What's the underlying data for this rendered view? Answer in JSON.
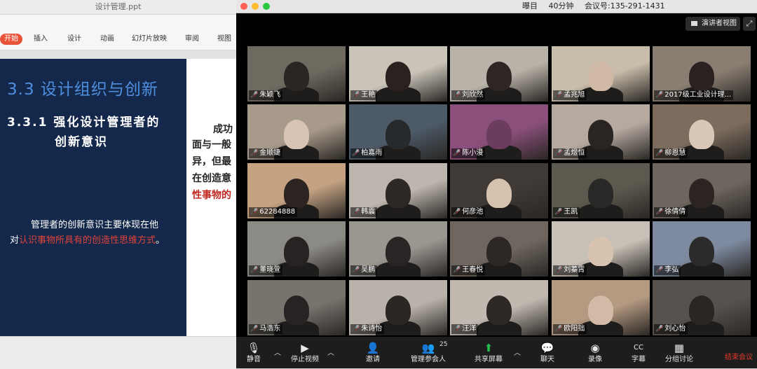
{
  "ppt": {
    "title": "设计管理.ppt",
    "tabs": [
      "开始",
      "插入",
      "设计",
      "动画",
      "幻灯片放映",
      "审阅",
      "视图"
    ],
    "slide": {
      "heading": "3.3 设计组织与创新",
      "subheading_line1": "3.3.1 强化设计管理者的",
      "subheading_line2": "创新意识",
      "para_line1": "管理者的创新意识主要体现在他",
      "para_line2_prefix": "对",
      "para_line2_red": "认识事物所具有的创造性思维方式",
      "para_line2_suffix": "。",
      "right_lines": [
        "成功",
        "面与一般",
        "异，但最",
        "在创造意",
        "性事物的"
      ]
    }
  },
  "zoom": {
    "title_parts": [
      "曝目",
      "40分钟",
      "会议号:135-291-1431"
    ],
    "speaker_view": "演讲者视图",
    "participants": [
      {
        "name": "朱颖飞",
        "wall": "#6f6a60",
        "skin": "#2a2624"
      },
      {
        "name": "王艳",
        "wall": "#c9c3b8",
        "skin": "#2b2220"
      },
      {
        "name": "刘欣然",
        "wall": "#b9b2a8",
        "skin": "#2e2623"
      },
      {
        "name": "孟兆旭",
        "wall": "#c8bcaa",
        "skin": "#cfb9a5"
      },
      {
        "name": "2017级工业设计理...",
        "wall": "#8a7e72",
        "skin": "#2a2220"
      },
      {
        "name": "金顺婕",
        "wall": "#a89a8a",
        "skin": "#d8c4b4"
      },
      {
        "name": "柏嘉雨",
        "wall": "#4d5a68",
        "skin": "#272a2c"
      },
      {
        "name": "陈小漫",
        "wall": "#8b4f7c",
        "skin": "#6b3c5e"
      },
      {
        "name": "孟煜恒",
        "wall": "#b5a9a0",
        "skin": "#2a2522"
      },
      {
        "name": "柳恩慧",
        "wall": "#7c6c5e",
        "skin": "#d9c7b8"
      },
      {
        "name": "62284888",
        "wall": "#c4a282",
        "skin": "#2b2420"
      },
      {
        "name": "韩震",
        "wall": "#bdb6ae",
        "skin": "#2d2826"
      },
      {
        "name": "何彦池",
        "wall": "#3f3a35",
        "skin": "#d6c2af"
      },
      {
        "name": "王凯",
        "wall": "#5c5a4f",
        "skin": "#2a2826"
      },
      {
        "name": "徐倩倩",
        "wall": "#6d655e",
        "skin": "#2c2422"
      },
      {
        "name": "董晓萱",
        "wall": "#8c8a84",
        "skin": "#272322"
      },
      {
        "name": "吴鹏",
        "wall": "#9a9690",
        "skin": "#292524"
      },
      {
        "name": "王春悦",
        "wall": "#6e665f",
        "skin": "#2d2725"
      },
      {
        "name": "刘蓁霄",
        "wall": "#c7c0b6",
        "skin": "#d8c3b0"
      },
      {
        "name": "李弘",
        "wall": "#7d8aa0",
        "skin": "#2c2a2a"
      },
      {
        "name": "马浩东",
        "wall": "#77736d",
        "skin": "#262322"
      },
      {
        "name": "朱诗怡",
        "wall": "#b9b2aa",
        "skin": "#2a2624"
      },
      {
        "name": "汪洋",
        "wall": "#c1b9b0",
        "skin": "#2d2826"
      },
      {
        "name": "欧阳拙",
        "wall": "#b59a82",
        "skin": "#d2bba6"
      },
      {
        "name": "刘心怡",
        "wall": "#57524d",
        "skin": "#2b2523"
      }
    ],
    "active_index": 13,
    "toolbar": {
      "mute": "静音",
      "stop_video": "停止视频",
      "invite": "邀请",
      "participants": "管理参会人",
      "participant_count": "25",
      "share": "共享屏幕",
      "chat": "聊天",
      "record": "录像",
      "cc": "字幕",
      "breakout": "分组讨论",
      "end": "结束会议"
    },
    "colors": {
      "end": "#e6372d",
      "share": "#27c24c",
      "active_border": "#d7e53b"
    }
  }
}
